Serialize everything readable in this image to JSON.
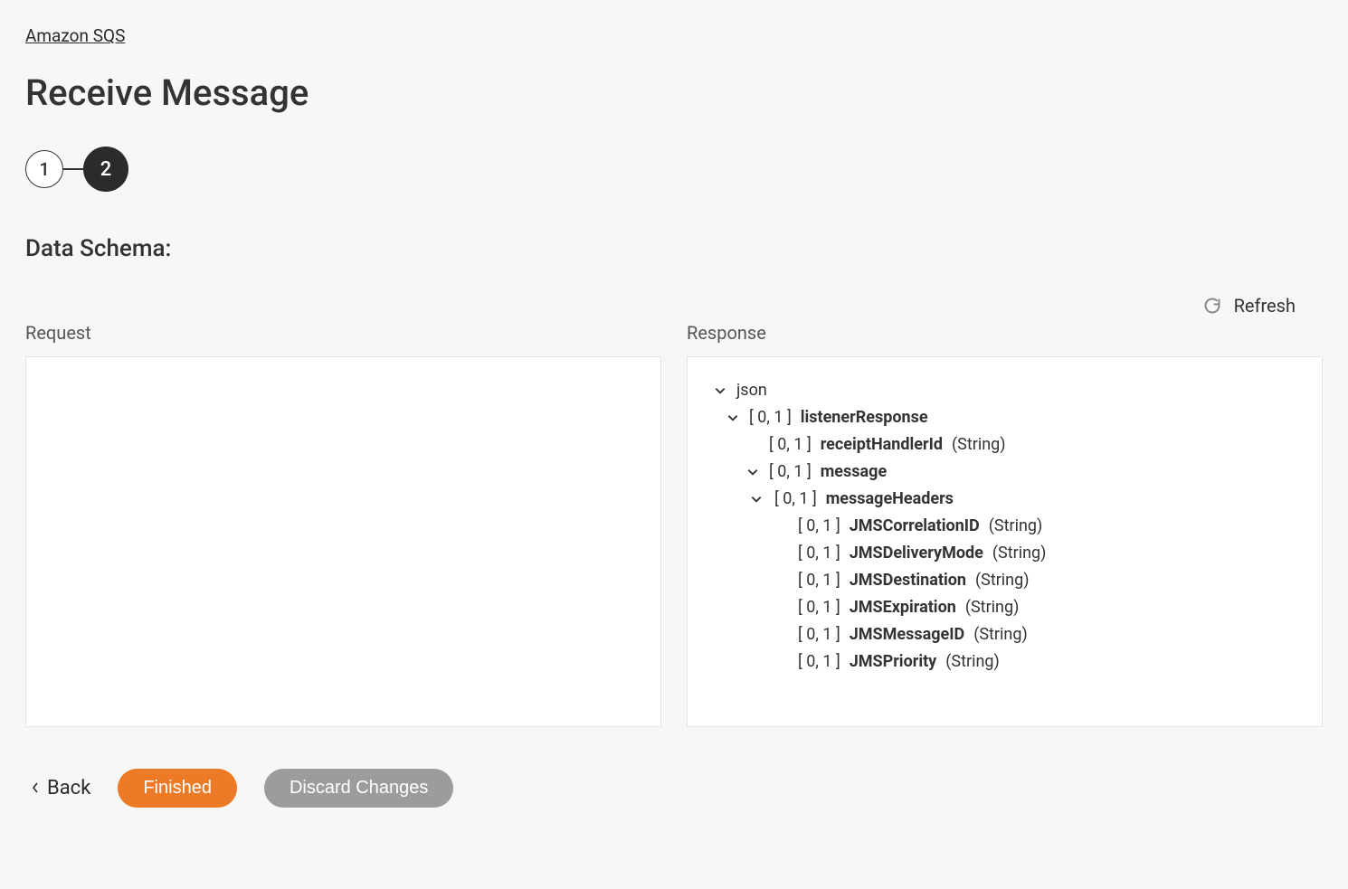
{
  "breadcrumb": "Amazon SQS",
  "page_title": "Receive Message",
  "stepper": {
    "step1": "1",
    "step2": "2"
  },
  "section_heading": "Data Schema:",
  "refresh_label": "Refresh",
  "columns": {
    "request_label": "Request",
    "response_label": "Response"
  },
  "response_tree": {
    "root": {
      "name": "json"
    },
    "listenerResponse": {
      "card": "[ 0, 1 ]",
      "name": "listenerResponse"
    },
    "receiptHandlerId": {
      "card": "[ 0, 1 ]",
      "name": "receiptHandlerId",
      "type": "(String)"
    },
    "message": {
      "card": "[ 0, 1 ]",
      "name": "message"
    },
    "messageHeaders": {
      "card": "[ 0, 1 ]",
      "name": "messageHeaders"
    },
    "jmsCorrelationID": {
      "card": "[ 0, 1 ]",
      "name": "JMSCorrelationID",
      "type": "(String)"
    },
    "jmsDeliveryMode": {
      "card": "[ 0, 1 ]",
      "name": "JMSDeliveryMode",
      "type": "(String)"
    },
    "jmsDestination": {
      "card": "[ 0, 1 ]",
      "name": "JMSDestination",
      "type": "(String)"
    },
    "jmsExpiration": {
      "card": "[ 0, 1 ]",
      "name": "JMSExpiration",
      "type": "(String)"
    },
    "jmsMessageID": {
      "card": "[ 0, 1 ]",
      "name": "JMSMessageID",
      "type": "(String)"
    },
    "jmsPriority": {
      "card": "[ 0, 1 ]",
      "name": "JMSPriority",
      "type": "(String)"
    }
  },
  "footer": {
    "back": "Back",
    "finished": "Finished",
    "discard": "Discard Changes"
  }
}
